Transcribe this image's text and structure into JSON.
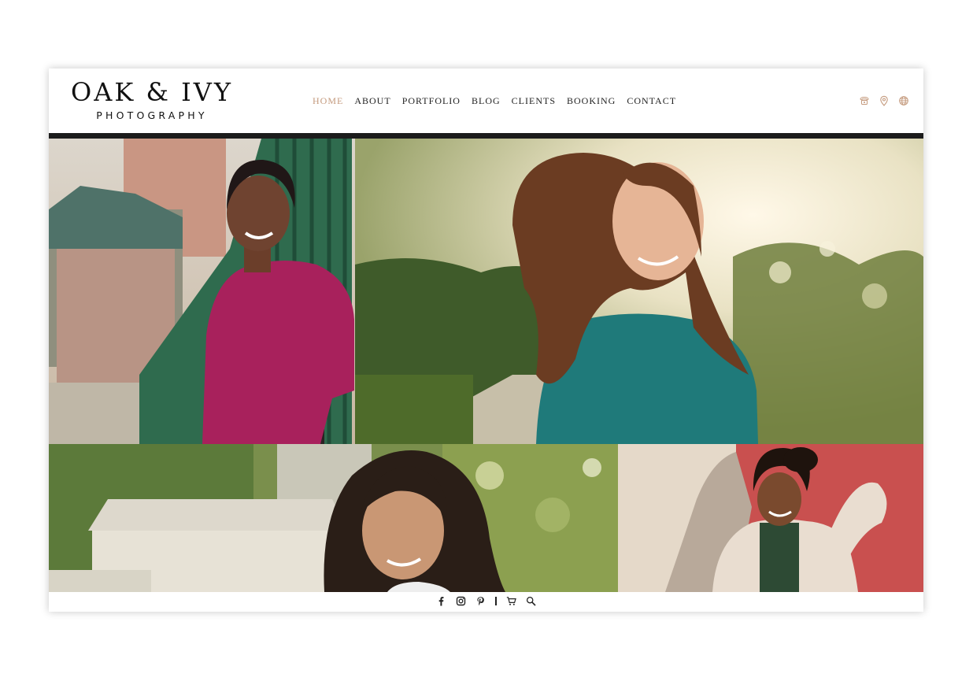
{
  "brand": {
    "name": "OAK & IVY",
    "tagline": "PHOTOGRAPHY"
  },
  "nav": {
    "items": [
      {
        "label": "HOME",
        "active": true
      },
      {
        "label": "ABOUT",
        "active": false
      },
      {
        "label": "PORTFOLIO",
        "active": false
      },
      {
        "label": "BLOG",
        "active": false
      },
      {
        "label": "CLIENTS",
        "active": false
      },
      {
        "label": "BOOKING",
        "active": false
      },
      {
        "label": "CONTACT",
        "active": false
      }
    ]
  },
  "header_icons": [
    "phone-icon",
    "map-pin-icon",
    "globe-icon"
  ],
  "gallery": {
    "photos": [
      "portrait-woman-pink-shirt-railing",
      "portrait-woman-teal-shirt-sunset",
      "portrait-woman-long-hair-garden",
      "portrait-man-denim-jacket-red-wall"
    ]
  },
  "footer_icons": [
    "facebook-icon",
    "instagram-icon",
    "pinterest-icon",
    "cart-icon",
    "search-icon"
  ],
  "colors": {
    "accent": "#c49a7d",
    "text": "#222222",
    "divider": "#1c1c1c"
  }
}
